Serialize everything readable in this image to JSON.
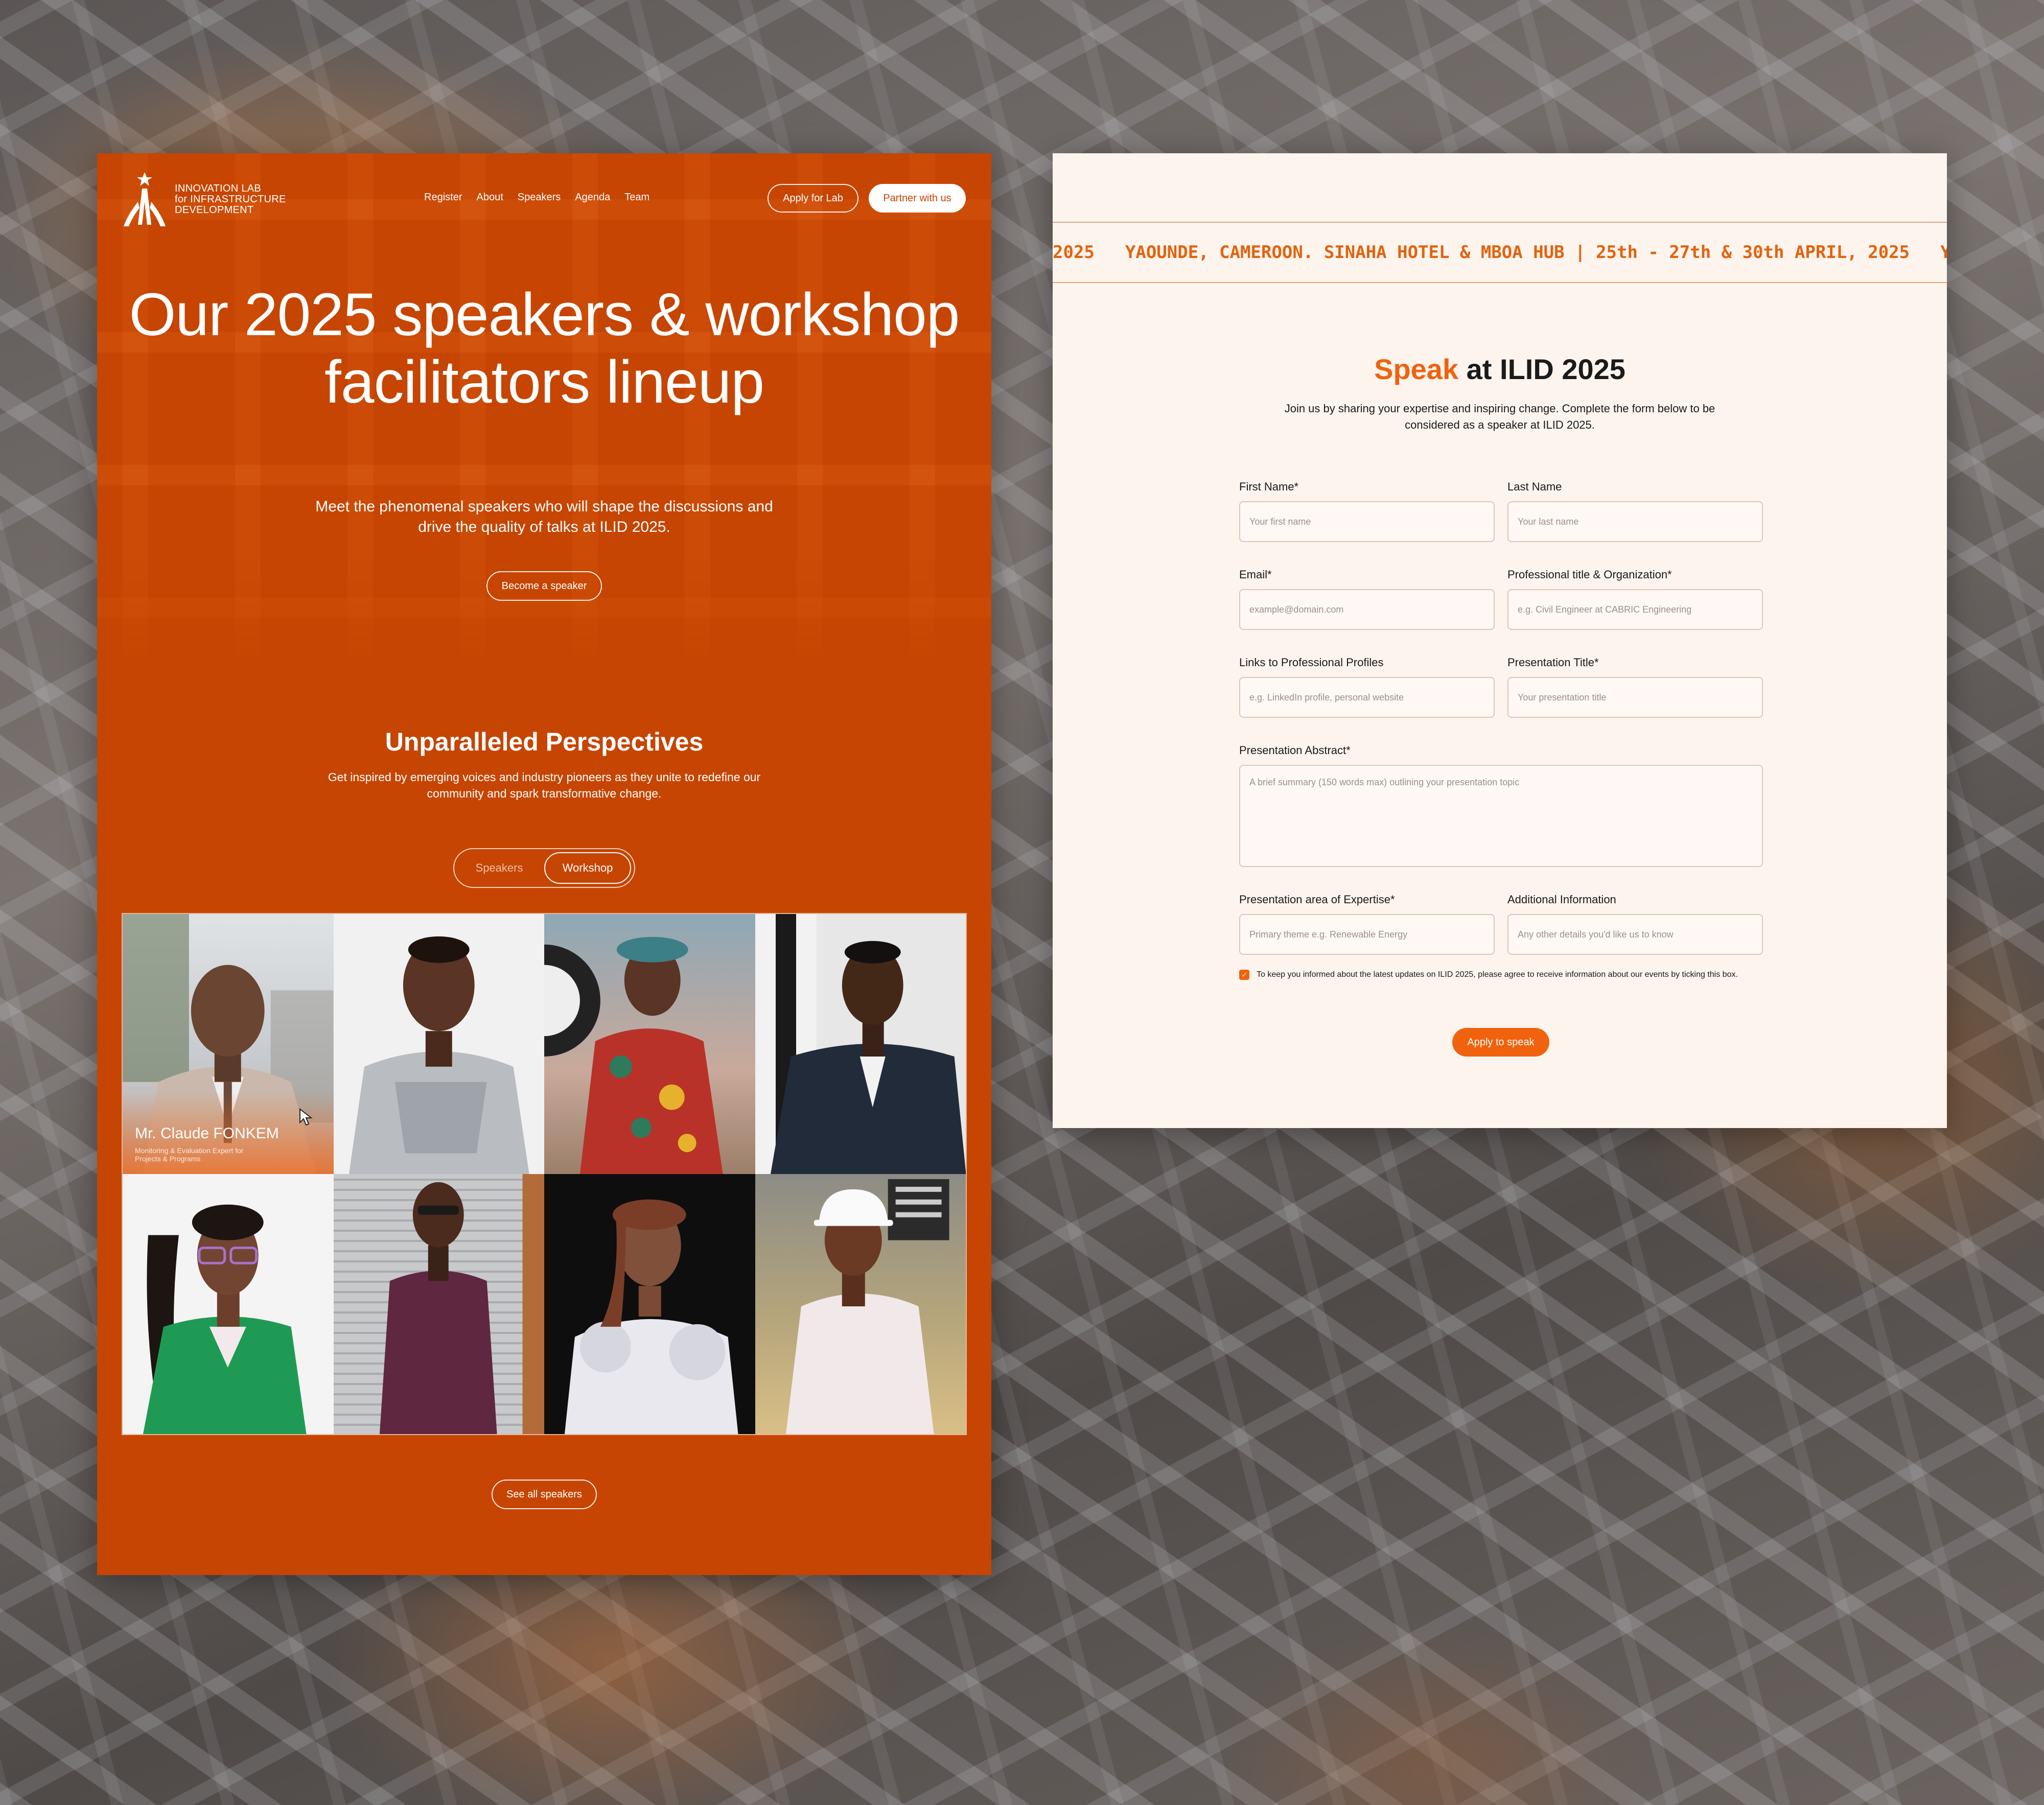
{
  "brand": {
    "logo_text": "INNOVATION LAB for INFRASTRUCTURE DEVELOPMENT",
    "accent_color": "#c64502",
    "form_accent_color": "#f0620d"
  },
  "nav": {
    "links": [
      "Register",
      "About",
      "Speakers",
      "Agenda",
      "Team"
    ],
    "apply_label": "Apply for Lab",
    "partner_label": "Partner with us"
  },
  "hero": {
    "title": "Our 2025 speakers & workshop facilitators lineup",
    "subtitle": "Meet the phenomenal speakers who will shape the discussions and drive the quality of talks at ILID 2025.",
    "cta_label": "Become a speaker"
  },
  "perspectives": {
    "title": "Unparalleled Perspectives",
    "subtitle": "Get inspired by emerging voices and industry pioneers as they unite to redefine our community and spark transformative change.",
    "toggle": {
      "speakers": "Speakers",
      "workshop": "Workshop",
      "active": "Workshop"
    }
  },
  "speakers": [
    {
      "name": "Mr. Claude FONKEM",
      "role": "Monitoring & Evaluation Expert for Projects & Programs"
    }
  ],
  "see_all_label": "See all speakers",
  "ticker": {
    "segment_a": "2025",
    "segment_b": "YAOUNDE, CAMEROON. SINAHA HOTEL & MBOA HUB | 25th - 27th & 30th APRIL, 2025",
    "segment_c": "YAOUNDE,"
  },
  "form": {
    "title_accent": "Speak",
    "title_rest": " at ILID 2025",
    "description": "Join us by sharing your expertise and inspiring change. Complete the form below to be considered as a speaker at ILID 2025.",
    "fields": {
      "first_name": {
        "label": "First Name*",
        "placeholder": "Your first name"
      },
      "last_name": {
        "label": "Last Name",
        "placeholder": "Your last name"
      },
      "email": {
        "label": "Email*",
        "placeholder": "example@domain.com"
      },
      "title_org": {
        "label": "Professional title & Organization*",
        "placeholder": "e.g. Civil Engineer at CABRIC Engineering"
      },
      "links": {
        "label": "Links to Professional Profiles",
        "placeholder": "e.g. LinkedIn profile, personal website"
      },
      "pres_title": {
        "label": "Presentation Title*",
        "placeholder": "Your presentation title"
      },
      "abstract": {
        "label": "Presentation Abstract*",
        "placeholder": "A brief summary (150 words max) outlining your presentation topic"
      },
      "expertise": {
        "label": "Presentation area of Expertise*",
        "placeholder": "Primary theme e.g. Renewable Energy"
      },
      "additional": {
        "label": "Additional Information",
        "placeholder": "Any other details you'd like us to know"
      }
    },
    "consent": "To keep you informed about the latest updates on ILID 2025, please agree to receive information about our events by ticking this box.",
    "consent_checked": true,
    "submit_label": "Apply to speak"
  }
}
